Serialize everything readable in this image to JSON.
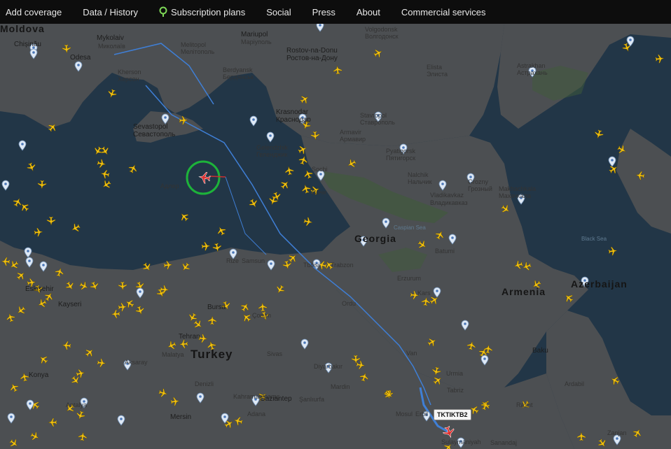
{
  "nav": {
    "items": [
      {
        "label": "Add coverage",
        "name": "nav-add-coverage"
      },
      {
        "label": "Data / History",
        "name": "nav-data-history"
      },
      {
        "label": "Subscription plans",
        "name": "nav-subscription-plans",
        "icon": "map-pin-icon"
      },
      {
        "label": "Social",
        "name": "nav-social"
      },
      {
        "label": "Press",
        "name": "nav-press"
      },
      {
        "label": "About",
        "name": "nav-about"
      },
      {
        "label": "Commercial services",
        "name": "nav-commercial-services"
      }
    ],
    "pin_color": "#7ed957"
  },
  "map": {
    "colors": {
      "sea": "#223647",
      "land": "#4c4f52",
      "route": "#3f7fd6",
      "plane": "#f2c10f",
      "selected_plane": "#e03030",
      "highlight_ring": "#1db33a"
    },
    "labels": [
      {
        "text": "Moldova",
        "cls": "lbl-country"
      },
      {
        "text": "Chișinău",
        "cls": "lbl-city"
      },
      {
        "text": "Mykolaiv",
        "cls": "lbl-city"
      },
      {
        "text": "Миколаїв",
        "cls": "lbl-city2"
      },
      {
        "text": "Odesa",
        "cls": "lbl-city"
      },
      {
        "text": "Kherson",
        "cls": "lbl-city2"
      },
      {
        "text": "Херсон",
        "cls": "lbl-city2"
      },
      {
        "text": "Melitopol",
        "cls": "lbl-city2"
      },
      {
        "text": "Мелітополь",
        "cls": "lbl-city2"
      },
      {
        "text": "Mariupol",
        "cls": "lbl-city"
      },
      {
        "text": "Маріуполь",
        "cls": "lbl-city2"
      },
      {
        "text": "Berdyansk",
        "cls": "lbl-city2"
      },
      {
        "text": "Бердянськ",
        "cls": "lbl-city2"
      },
      {
        "text": "Rostov-na-Donu",
        "cls": "lbl-city"
      },
      {
        "text": "Ростов-на-Дону",
        "cls": "lbl-city"
      },
      {
        "text": "Volgodonsk",
        "cls": "lbl-city2"
      },
      {
        "text": "Волгодонск",
        "cls": "lbl-city2"
      },
      {
        "text": "Elista",
        "cls": "lbl-city2"
      },
      {
        "text": "Элиста",
        "cls": "lbl-city2"
      },
      {
        "text": "Astrakhan",
        "cls": "lbl-city2"
      },
      {
        "text": "Астрахань",
        "cls": "lbl-city2"
      },
      {
        "text": "Sevastopol",
        "cls": "lbl-city"
      },
      {
        "text": "Севастополь",
        "cls": "lbl-city"
      },
      {
        "text": "Krasnodar",
        "cls": "lbl-city"
      },
      {
        "text": "Краснодар",
        "cls": "lbl-city"
      },
      {
        "text": "Stavropol",
        "cls": "lbl-city2"
      },
      {
        "text": "Ставрополь",
        "cls": "lbl-city2"
      },
      {
        "text": "Armavir",
        "cls": "lbl-city2"
      },
      {
        "text": "Армавир",
        "cls": "lbl-city2"
      },
      {
        "text": "Gelendzhik",
        "cls": "lbl-city2"
      },
      {
        "text": "Геленджик",
        "cls": "lbl-city2"
      },
      {
        "text": "Pyatigorsk",
        "cls": "lbl-city2"
      },
      {
        "text": "Пятигорск",
        "cls": "lbl-city2"
      },
      {
        "text": "Nalchik",
        "cls": "lbl-city2"
      },
      {
        "text": "Нальчик",
        "cls": "lbl-city2"
      },
      {
        "text": "Grozny",
        "cls": "lbl-city2"
      },
      {
        "text": "Грозный",
        "cls": "lbl-city2"
      },
      {
        "text": "Vladikavkaz",
        "cls": "lbl-city2"
      },
      {
        "text": "Владикавказ",
        "cls": "lbl-city2"
      },
      {
        "text": "Makhachkala",
        "cls": "lbl-city2"
      },
      {
        "text": "Махачкала",
        "cls": "lbl-city2"
      },
      {
        "text": "Sochi",
        "cls": "lbl-city2"
      },
      {
        "text": "Сочи",
        "cls": "lbl-city2"
      },
      {
        "text": "Адлер",
        "cls": "lbl-city2"
      },
      {
        "text": "Black Sea",
        "cls": "lbl-sea"
      },
      {
        "text": "Caspian Sea",
        "cls": "lbl-sea"
      },
      {
        "text": "Georgia",
        "cls": "lbl-country"
      },
      {
        "text": "Batumi",
        "cls": "lbl-city2"
      },
      {
        "text": "Tbilisi",
        "cls": "lbl-city2"
      },
      {
        "text": "Trabzon",
        "cls": "lbl-city2"
      },
      {
        "text": "Rize",
        "cls": "lbl-city2"
      },
      {
        "text": "Samsun",
        "cls": "lbl-city2"
      },
      {
        "text": "Ordu",
        "cls": "lbl-city2"
      },
      {
        "text": "Erzurum",
        "cls": "lbl-city2"
      },
      {
        "text": "Kars",
        "cls": "lbl-city2"
      },
      {
        "text": "Armenia",
        "cls": "lbl-country"
      },
      {
        "text": "Azerbaijan",
        "cls": "lbl-country"
      },
      {
        "text": "Baku",
        "cls": "lbl-city"
      },
      {
        "text": "Ardabil",
        "cls": "lbl-city2"
      },
      {
        "text": "Rasht",
        "cls": "lbl-city2"
      },
      {
        "text": "Zanjan",
        "cls": "lbl-city2"
      },
      {
        "text": "Tehran",
        "cls": "lbl-city"
      },
      {
        "text": "Turkey",
        "cls": "lbl-big"
      },
      {
        "text": "Kayseri",
        "cls": "lbl-city"
      },
      {
        "text": "Eskişehir",
        "cls": "lbl-city"
      },
      {
        "text": "Bursa",
        "cls": "lbl-city"
      },
      {
        "text": "Çorum",
        "cls": "lbl-city2"
      },
      {
        "text": "Sivas",
        "cls": "lbl-city2"
      },
      {
        "text": "Malatya",
        "cls": "lbl-city2"
      },
      {
        "text": "Aksaray",
        "cls": "lbl-city2"
      },
      {
        "text": "Konya",
        "cls": "lbl-city"
      },
      {
        "text": "Denizli",
        "cls": "lbl-city2"
      },
      {
        "text": "Kahramanmaraş",
        "cls": "lbl-city2"
      },
      {
        "text": "Gaziantep",
        "cls": "lbl-city"
      },
      {
        "text": "Şanlıurfa",
        "cls": "lbl-city2"
      },
      {
        "text": "Diyarbakır",
        "cls": "lbl-city2"
      },
      {
        "text": "Mardin",
        "cls": "lbl-city2"
      },
      {
        "text": "Van",
        "cls": "lbl-city2"
      },
      {
        "text": "Urmia",
        "cls": "lbl-city2"
      },
      {
        "text": "Tabriz",
        "cls": "lbl-city2"
      },
      {
        "text": "Mosul",
        "cls": "lbl-city2"
      },
      {
        "text": "Erbil",
        "cls": "lbl-city2"
      },
      {
        "text": "Sulaymaniyah",
        "cls": "lbl-city2"
      },
      {
        "text": "Sanandaj",
        "cls": "lbl-city2"
      },
      {
        "text": "Mersin",
        "cls": "lbl-city"
      },
      {
        "text": "Adana",
        "cls": "lbl-city2"
      },
      {
        "text": "Antalya",
        "cls": "lbl-city2"
      }
    ],
    "selected_flight": {
      "callsign": "TKTIKTB2"
    }
  }
}
